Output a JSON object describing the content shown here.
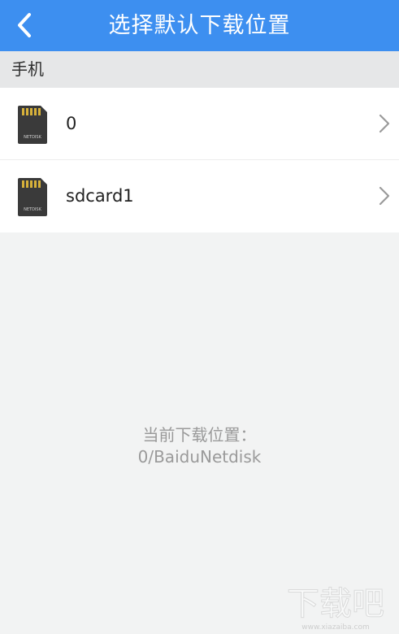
{
  "header": {
    "title": "选择默认下载位置",
    "back_icon": "chevron-left-icon",
    "background_color": "#3d8ff0"
  },
  "section": {
    "title": "手机"
  },
  "storage_items": [
    {
      "label": "0",
      "icon": "sd-card-icon",
      "icon_text": "NETDISK"
    },
    {
      "label": "sdcard1",
      "icon": "sd-card-icon",
      "icon_text": "NETDISK"
    }
  ],
  "current_location": {
    "label": "当前下载位置：",
    "path": "0/BaiduNetdisk"
  },
  "watermark": {
    "text": "下载吧",
    "subtext": "www.xiazaiba.com"
  }
}
